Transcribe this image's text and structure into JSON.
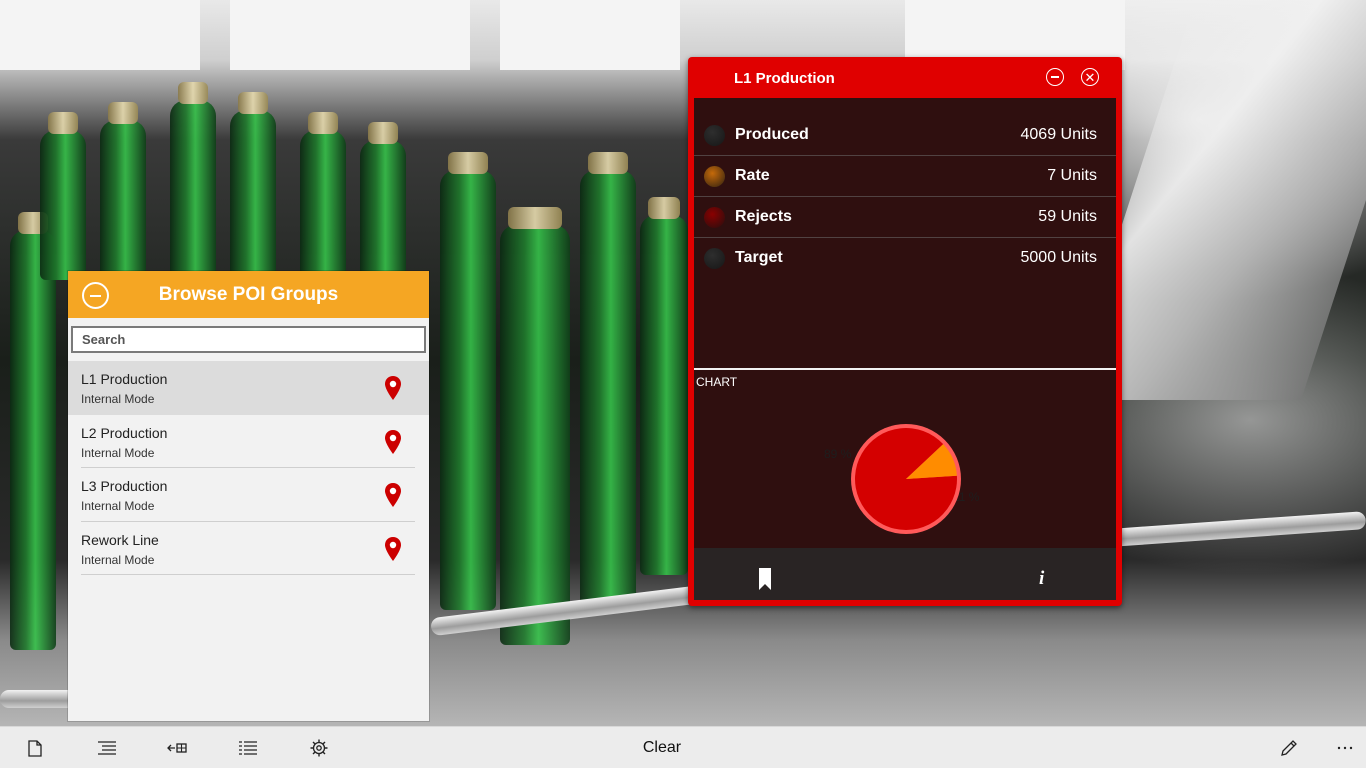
{
  "poi_panel": {
    "title": "Browse POI Groups",
    "search_placeholder": "Search",
    "items": [
      {
        "name": "L1 Production",
        "mode": "Internal Mode"
      },
      {
        "name": "L2 Production",
        "mode": "Internal Mode"
      },
      {
        "name": "L3 Production",
        "mode": "Internal Mode"
      },
      {
        "name": "Rework Line",
        "mode": "Internal Mode"
      }
    ],
    "header_color": "#f5a623",
    "pin_color": "#cc0000"
  },
  "production_panel": {
    "title": "L1 Production",
    "accent_color": "#e00000",
    "metrics": [
      {
        "label": "Produced",
        "value": "4069 Units",
        "color": "#2e2e2e"
      },
      {
        "label": "Rate",
        "value": "7 Units",
        "color": "#c56a0a"
      },
      {
        "label": "Rejects",
        "value": "59 Units",
        "color": "#8a0000"
      },
      {
        "label": "Target",
        "value": "5000 Units",
        "color": "#2e2e2e"
      }
    ],
    "chart_label": "CHART",
    "chart": {
      "type": "pie",
      "slices": [
        {
          "value": 89,
          "label": "89 %",
          "color": "#d40000"
        },
        {
          "value": 11,
          "label": "11 %",
          "color": "#ff8c00"
        }
      ]
    }
  },
  "appbar": {
    "clear_label": "Clear",
    "icons": [
      "new-document-icon",
      "indent-list-icon",
      "back-grid-icon",
      "list-icon",
      "settings-icon",
      "edit-icon",
      "more-icon"
    ]
  }
}
